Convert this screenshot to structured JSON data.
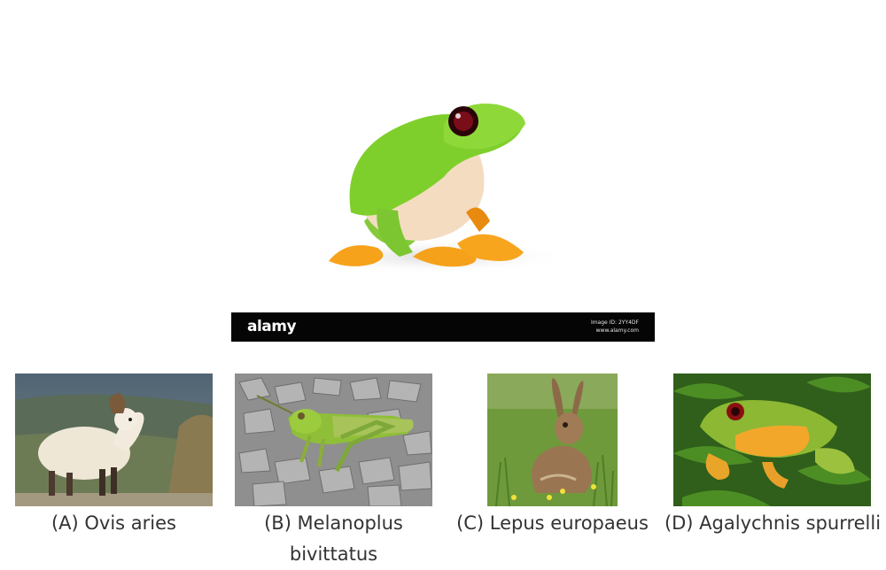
{
  "main_image": {
    "subject": "red-eyed tree frog",
    "watermark_brand": "alamy",
    "watermark_line1": "Image ID: 2YY4DF",
    "watermark_line2": "www.alamy.com"
  },
  "options": [
    {
      "label": "(A) Ovis aries",
      "icon": "sheep-photo"
    },
    {
      "label": "(B) Melanoplus",
      "label_line2": "bivittatus",
      "icon": "grasshopper-photo"
    },
    {
      "label": "(C) Lepus europaeus",
      "icon": "hare-photo"
    },
    {
      "label": "(D) Agalychnis spurrelli",
      "icon": "tree-frog-photo"
    }
  ]
}
